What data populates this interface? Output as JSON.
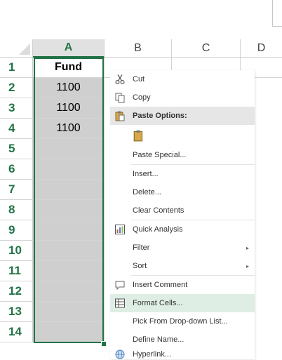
{
  "columns": [
    "A",
    "B",
    "C",
    "D"
  ],
  "rows": [
    "1",
    "2",
    "3",
    "4",
    "5",
    "6",
    "7",
    "8",
    "9",
    "10",
    "11",
    "12",
    "13",
    "14"
  ],
  "column_a": [
    "Fund",
    "1100",
    "1100",
    "1100",
    "",
    "",
    "",
    "",
    "",
    "",
    "",
    "",
    "",
    ""
  ],
  "context_menu": {
    "cut": "Cut",
    "copy": "Copy",
    "paste_options": "Paste Options:",
    "paste_special": "Paste Special...",
    "insert": "Insert...",
    "delete": "Delete...",
    "clear_contents": "Clear Contents",
    "quick_analysis": "Quick Analysis",
    "filter": "Filter",
    "sort": "Sort",
    "insert_comment": "Insert Comment",
    "format_cells": "Format Cells...",
    "pick_from_list": "Pick From Drop-down List...",
    "define_name": "Define Name...",
    "hyperlink": "Hyperlink...",
    "submenu_arrow": "▸"
  },
  "colors": {
    "accent": "#217346",
    "selection_fill": "#cfcfcf",
    "highlight": "#dfeee4"
  }
}
